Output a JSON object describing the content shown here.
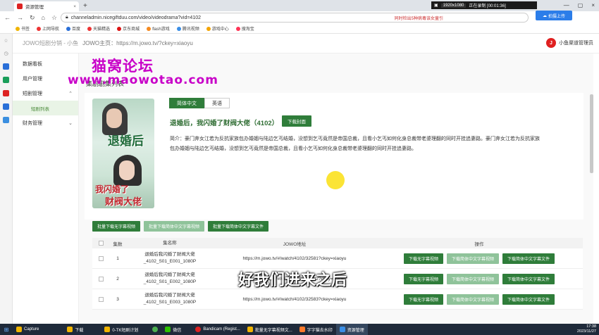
{
  "browser": {
    "tab_title": "资源管理",
    "new_tab": "+",
    "url": "channeladmin.nicegiftduu.com/video/videodrama?vid=4102",
    "bookmarks": [
      "书签",
      "上网导航",
      "百度",
      "天猫精选",
      "京东商城",
      "flash游戏",
      "腾讯视频",
      "游戏中心",
      "搜淘宝"
    ]
  },
  "recording": {
    "resolution": "1920x1080",
    "status": "正在录制 [00:01:36]",
    "notice": "同时检出5种病毒该女童引"
  },
  "upload_button": "拍摄上传",
  "app": {
    "title": "JOWO短剧分销 - 小鱼",
    "home": "JOWO主页：https://m.jowo.tv/?ckey=xiaoyu",
    "user": "小鱼渠道管理员"
  },
  "nav": [
    {
      "label": "数据看板",
      "sub": false,
      "chevron": ""
    },
    {
      "label": "用户管理",
      "sub": false,
      "chevron": ""
    },
    {
      "label": "短剧管理",
      "sub": false,
      "chevron": "^"
    },
    {
      "label": "短剧列表",
      "sub": true,
      "chevron": ""
    },
    {
      "label": "财务管理",
      "sub": false,
      "chevron": "v"
    }
  ],
  "watermark": {
    "line1": "猫窝论坛",
    "line2": "www.maowotao.com"
  },
  "breadcrumb": "集剧剧集列表",
  "drama": {
    "lang_tabs": [
      "简体中文",
      "英语"
    ],
    "title": "退婚后，我闪婚了财阀大佬（4102）",
    "download_cover": "下载封面",
    "synopsis": "简介：豪门弃女江若为反抗家族包办婚姻与陆边乞丐结婚，没想到乞丐竟然是帝国总裁，且看小乞丐如何化身总裁带老婆理翻的同时开挂追妻路。豪门弃女江若为反抗家族包办婚姻与陆边乞丐结婚，没想到乞丐竟然是帝国总裁，且看小乞丐如何化身总裁带老婆理翻的同时开挂追妻路。",
    "poster_line1": "退婚后",
    "poster_line2": "我闪婚了",
    "poster_line3": "财阀大佬"
  },
  "batch_buttons": [
    "批量下载无字幕视频",
    "批量下载简体中文字幕视频",
    "批量下载简体中文字幕文件"
  ],
  "table": {
    "headers": {
      "ep": "集数",
      "name": "集名称",
      "url": "JOWO地址",
      "ops": "操作"
    },
    "rows": [
      {
        "ep": "1",
        "name1": "退婚后我闪婚了财阀大佬",
        "name2": "_4102_S01_E001_1080P",
        "url": "https://m.jowo.tv/#/watch/4102/32581?ckey=xiaoyu"
      },
      {
        "ep": "2",
        "name1": "退婚后我闪婚了财阀大佬",
        "name2": "_4102_S01_E002_1080P",
        "url": "https://m.jowo.tv/#/watch/4102/32582?ckey=xiaoyu"
      },
      {
        "ep": "3",
        "name1": "退婚后我闪婚了财阀大佬",
        "name2": "_4102_S01_E003_1080P",
        "url": "https://m.jowo.tv/#/watch/4102/32583?ckey=xiaoyu"
      }
    ],
    "op_buttons": [
      "下载无字幕视频",
      "下载简体中文字幕视频",
      "下载简体中文字幕文件"
    ]
  },
  "subtitle": "好我们进来之后",
  "taskbar": {
    "items": [
      "Capture",
      "下载",
      "0-TK短剧计划",
      "微信",
      "Bandicam (Regist...",
      "批量无字幕视频文...",
      "字字猫去水印",
      "资源管理"
    ],
    "time": "17:38",
    "date": "2023/11/27"
  },
  "colors": {
    "accent": "#2f7d3a",
    "accent_light": "#8fc39a",
    "watermark": "#c800c8"
  }
}
